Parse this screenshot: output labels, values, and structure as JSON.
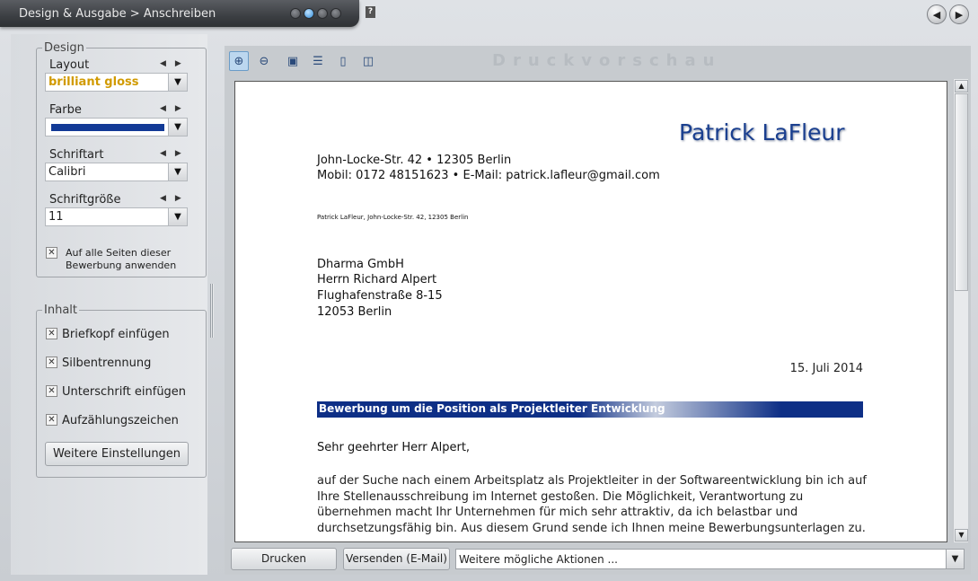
{
  "window": {
    "breadcrumb": "Design & Ausgabe > Anschreiben",
    "help": "?"
  },
  "design": {
    "legend": "Design",
    "layout_label": "Layout",
    "layout_value": "brilliant gloss",
    "farbe_label": "Farbe",
    "farbe_color": "#123a96",
    "schriftart_label": "Schriftart",
    "schriftart_value": "Calibri",
    "schriftgroesse_label": "Schriftgröße",
    "schriftgroesse_value": "11",
    "apply_all_line1": "Auf alle Seiten dieser",
    "apply_all_line2": "Bewerbung anwenden",
    "apply_all_checked": true
  },
  "inhalt": {
    "legend": "Inhalt",
    "options": [
      {
        "label": "Briefkopf einfügen",
        "checked": true
      },
      {
        "label": "Silbentrennung",
        "checked": true
      },
      {
        "label": "Unterschrift einfügen",
        "checked": true
      },
      {
        "label": "Aufzählungszeichen",
        "checked": true
      }
    ],
    "more_button": "Weitere Einstellungen"
  },
  "preview": {
    "title": "Druckvorschau",
    "letter": {
      "sender_name": "Patrick LaFleur",
      "address_line1": "John-Locke-Str. 42  •  12305 Berlin",
      "address_line2": "Mobil: 0172 48151623  •  E-Mail: patrick.lafleur@gmail.com",
      "return_address": "Patrick LaFleur, John-Locke-Str. 42, 12305 Berlin",
      "recipient": [
        "Dharma GmbH",
        "Herrn Richard Alpert",
        "Flughafenstraße 8-15",
        "12053 Berlin"
      ],
      "date": "15. Juli 2014",
      "subject": "Bewerbung um die Position als Projektleiter Entwicklung",
      "salutation": "Sehr geehrter Herr Alpert,",
      "body": "auf der Suche nach einem Arbeitsplatz als Projektleiter in der Softwareentwicklung bin ich auf Ihre Stellenausschreibung im Internet gestoßen. Die Möglichkeit, Verantwortung zu übernehmen macht Ihr Unternehmen für mich sehr attraktiv, da ich belastbar und durchsetzungsfähig bin. Aus diesem Grund sende ich Ihnen meine Bewerbungsunterlagen zu."
    }
  },
  "actions": {
    "print": "Drucken",
    "send": "Versenden (E-Mail)",
    "more_actions": "Weitere mögliche Aktionen ..."
  }
}
